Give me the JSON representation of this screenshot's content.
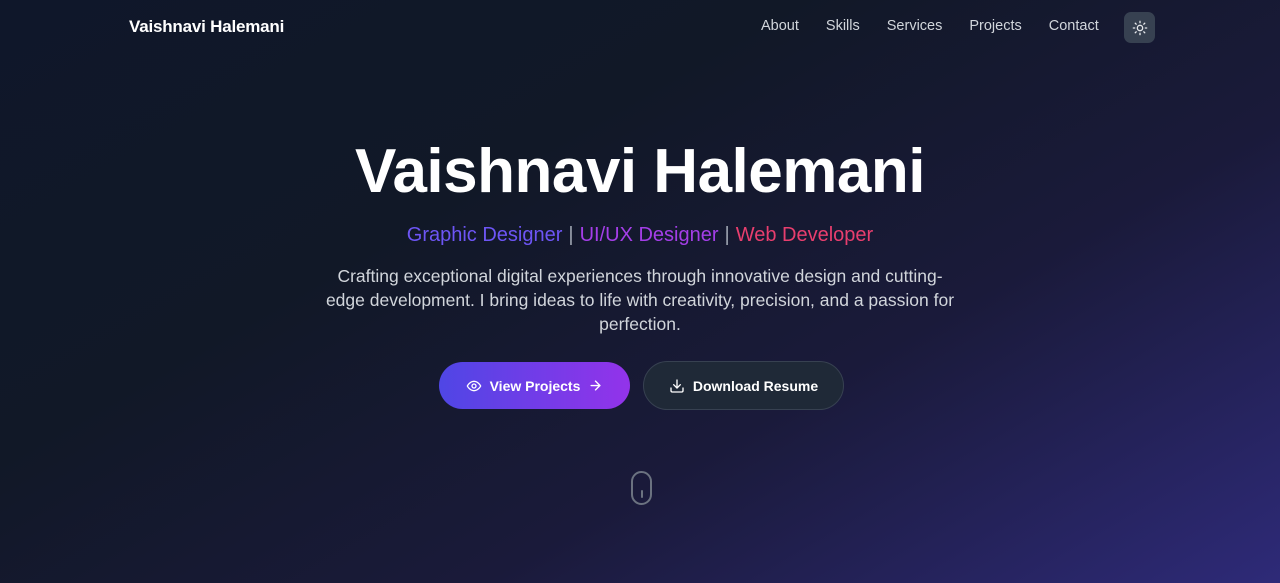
{
  "nav": {
    "brand": "Vaishnavi Halemani",
    "links": [
      {
        "label": "About"
      },
      {
        "label": "Skills"
      },
      {
        "label": "Services"
      },
      {
        "label": "Projects"
      },
      {
        "label": "Contact"
      }
    ],
    "theme_toggle_icon": "sun-icon"
  },
  "hero": {
    "title": "Vaishnavi Halemani",
    "roles": [
      "Graphic Designer",
      "UI/UX Designer",
      "Web Developer"
    ],
    "separator": "|",
    "description": "Crafting exceptional digital experiences through innovative design and cutting-edge development. I bring ideas to life with creativity, precision, and a passion for perfection.",
    "primary_button": {
      "label": "View Projects",
      "icon_left": "eye-icon",
      "icon_right": "arrow-right-icon"
    },
    "secondary_button": {
      "label": "Download Resume",
      "icon_left": "download-icon"
    }
  },
  "colors": {
    "role_1": "#6d55f5",
    "role_2": "#a43ee8",
    "role_3": "#e83e6e",
    "primary_gradient_start": "#4f46e5",
    "primary_gradient_end": "#9333ea"
  }
}
